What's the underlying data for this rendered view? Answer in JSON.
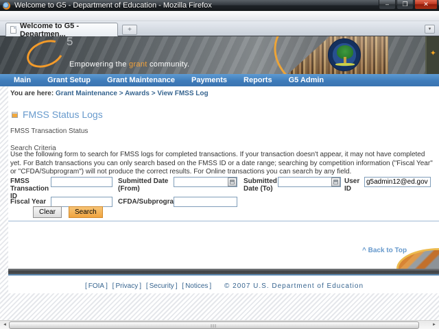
{
  "window": {
    "title": "Welcome to G5 - Department of Education - Mozilla Firefox",
    "controls": {
      "minimize": "–",
      "restore": "❐",
      "close": "✕"
    }
  },
  "tabs": {
    "active_label": "Welcome to G5 - Departmen...",
    "new_tab": "+",
    "list_all": "▾"
  },
  "header": {
    "logo_five": "5",
    "tagline_pre": "Empowering the ",
    "tagline_accent": "grant",
    "tagline_post": " community.",
    "star": "✦"
  },
  "nav": {
    "items": [
      {
        "label": "Main"
      },
      {
        "label": "Grant Setup"
      },
      {
        "label": "Grant Maintenance"
      },
      {
        "label": "Payments"
      },
      {
        "label": "Reports"
      },
      {
        "label": "G5 Admin"
      }
    ]
  },
  "breadcrumb": {
    "prefix": "You are here: ",
    "path": "Grant Maintenance > Awards > View FMSS Log"
  },
  "page": {
    "title": "FMSS Status Logs",
    "subtitle": "FMSS Transaction Status",
    "section": "Search Criteria",
    "instructions": "Use the following form to search for FMSS logs for completed transactions. If your transaction doesn't appear, it may not have completed yet. For Batch transactions you can only search based on the FMSS ID or a date range; searching by competition information (\"Fiscal Year\" or \"CFDA/Subprogram\") will not produce the correct results. For Online transactions you can search by any field."
  },
  "form": {
    "fmss_id_label": "FMSS Transaction ID",
    "fmss_id_value": "",
    "date_from_label": "Submitted Date (From)",
    "date_from_value": "",
    "date_to_label": "Submitted Date (To)",
    "date_to_value": "",
    "user_id_label": "User ID",
    "user_id_value": "g5admin12@ed.gov",
    "fiscal_year_label": "Fiscal Year",
    "fiscal_year_value": "",
    "cfda_label": "CFDA/Subprogram",
    "cfda_value": "",
    "clear_button": "Clear",
    "search_button": "Search"
  },
  "back_to_top": "^ Back to Top",
  "footer": {
    "lb": "[",
    "rb": "]",
    "links": [
      {
        "label": "FOIA"
      },
      {
        "label": "Privacy"
      },
      {
        "label": "Security"
      },
      {
        "label": "Notices"
      }
    ],
    "copyright": "© 2007 U.S. Department of Education"
  },
  "scrollbar": {
    "left_arrow": "◄",
    "right_arrow": "►"
  },
  "colors": {
    "nav_blue": "#4a86c0",
    "accent_orange": "#f2a83c",
    "link_blue": "#36648f",
    "title_blue": "#6699cc",
    "close_red": "#c13a22"
  }
}
